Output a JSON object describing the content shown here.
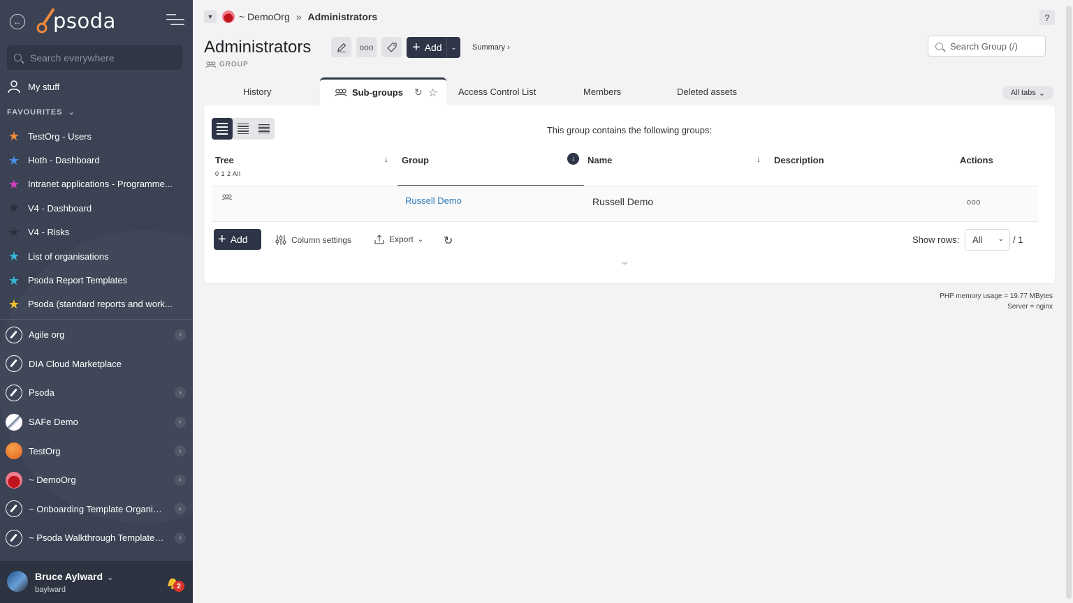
{
  "sidebar": {
    "logo_text": "psoda",
    "search_placeholder": "Search everywhere",
    "my_stuff": "My stuff",
    "favourites_label": "FAVOURITES",
    "favourites": [
      {
        "label": "TestOrg - Users",
        "color": "#f08a3a"
      },
      {
        "label": "Hoth - Dashboard",
        "color": "#4a90e2"
      },
      {
        "label": "Intranet applications - Programme...",
        "color": "#d63fc4"
      },
      {
        "label": "V4 - Dashboard",
        "color": "#2a2f3a"
      },
      {
        "label": "V4 - Risks",
        "color": "#2a2f3a"
      },
      {
        "label": "List of organisations",
        "color": "#38b6d8"
      },
      {
        "label": "Psoda Report Templates",
        "color": "#38b6d8"
      },
      {
        "label": "Psoda (standard reports and work...",
        "color": "#f2c12e"
      }
    ],
    "orgs": [
      {
        "label": "Agile org",
        "icon": "rocket-icon",
        "arrow": true
      },
      {
        "label": "DIA Cloud Marketplace",
        "icon": "rocket-icon",
        "arrow": false
      },
      {
        "label": "Psoda",
        "icon": "rocket-icon",
        "arrow": true
      },
      {
        "label": "SAFe Demo",
        "icon": "safe-logo-icon",
        "arrow": true
      },
      {
        "label": "TestOrg",
        "icon": "orange-circle-icon",
        "arrow": true
      },
      {
        "label": "~ DemoOrg",
        "icon": "sunset-icon",
        "arrow": true
      },
      {
        "label": "~ Onboarding Template Organisa...",
        "icon": "rocket-icon",
        "arrow": true
      },
      {
        "label": "~ Psoda Walkthrough Template P...",
        "icon": "rocket-icon",
        "arrow": true
      }
    ],
    "user": {
      "name": "Bruce Aylward",
      "login": "baylward",
      "notifications": "2"
    }
  },
  "breadcrumb": {
    "org": "~ DemoOrg",
    "sep": "»",
    "current": "Administrators"
  },
  "header": {
    "title": "Administrators",
    "subtitle": "GROUP",
    "add_label": "Add",
    "summary_label": "Summary ›",
    "search_placeholder": "Search Group (/)",
    "help": "?"
  },
  "tabs": {
    "items": [
      "History",
      "Sub-groups",
      "Access Control List",
      "Members",
      "Deleted assets"
    ],
    "active": "Sub-groups",
    "all_tabs": "All tabs"
  },
  "panel": {
    "caption": "This group contains the following groups:",
    "columns": [
      "Tree",
      "Group",
      "Name",
      "Description",
      "Actions"
    ],
    "tree_levels": "0 1 2 All",
    "rows": [
      {
        "group": "Russell Demo",
        "name": "Russell Demo",
        "actions": "ooo"
      }
    ],
    "add_label": "Add",
    "column_settings": "Column settings",
    "export": "Export",
    "show_rows_label": "Show rows:",
    "show_rows_value": "All",
    "pages": "/ 1"
  },
  "footer": {
    "memory": "PHP memory usage = 19.77 MBytes",
    "server": "Server = nginx"
  }
}
